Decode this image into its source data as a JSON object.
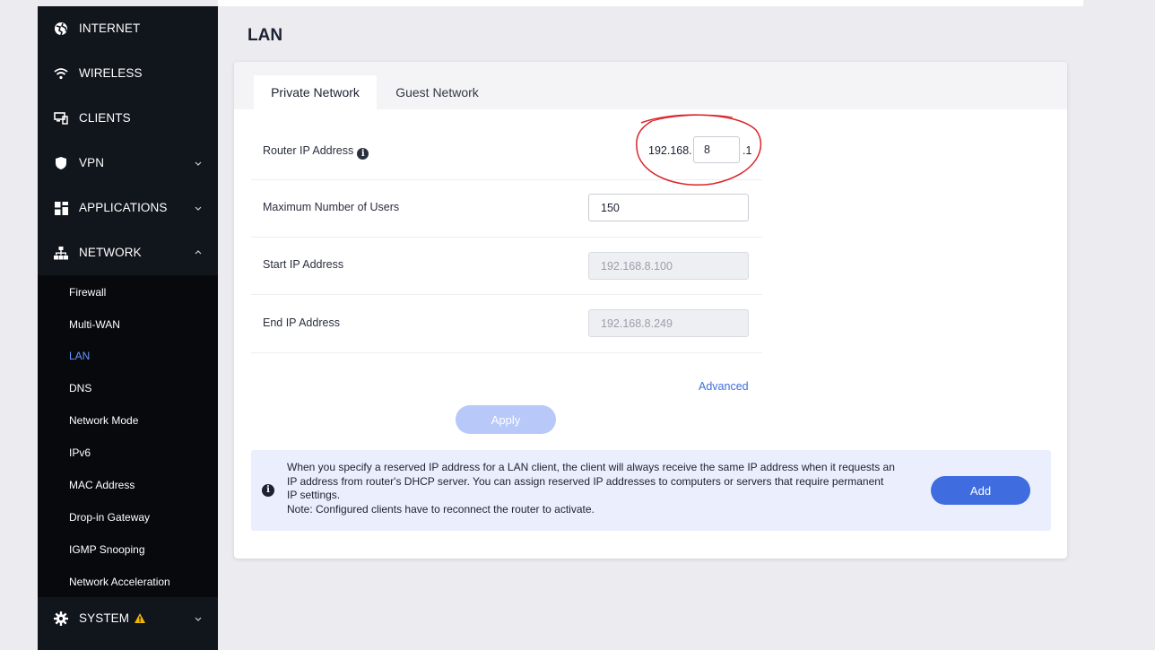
{
  "sidebar": {
    "items": [
      {
        "label": "INTERNET",
        "icon": "globe-icon"
      },
      {
        "label": "WIRELESS",
        "icon": "wifi-icon"
      },
      {
        "label": "CLIENTS",
        "icon": "devices-icon"
      },
      {
        "label": "VPN",
        "icon": "shield-icon"
      },
      {
        "label": "APPLICATIONS",
        "icon": "apps-icon"
      },
      {
        "label": "NETWORK",
        "icon": "network-icon"
      },
      {
        "label": "SYSTEM",
        "icon": "gear-icon"
      }
    ],
    "network_subitems": [
      "Firewall",
      "Multi-WAN",
      "LAN",
      "DNS",
      "Network Mode",
      "IPv6",
      "MAC Address",
      "Drop-in Gateway",
      "IGMP Snooping",
      "Network Acceleration"
    ],
    "active_subitem": "LAN",
    "accent_color": "#6a97ff",
    "warning_color": "#f2b600"
  },
  "page": {
    "title": "LAN",
    "tabs": [
      "Private Network",
      "Guest Network"
    ],
    "active_tab": "Private Network"
  },
  "form": {
    "router_ip_label": "Router IP Address",
    "router_ip_prefix": "192.168.",
    "router_ip_octet": "8",
    "router_ip_suffix": ".1",
    "max_users_label": "Maximum Number of Users",
    "max_users_value": "150",
    "start_ip_label": "Start IP Address",
    "start_ip_value": "192.168.8.100",
    "end_ip_label": "End IP Address",
    "end_ip_value": "192.168.8.249",
    "advanced_label": "Advanced",
    "apply_label": "Apply"
  },
  "notice": {
    "line1": "When you specify a reserved IP address for a LAN client, the client will always receive the same IP address when it requests an",
    "line2": "IP address from router's DHCP server. You can assign reserved IP addresses to computers or servers that require permanent",
    "line3": "IP settings.",
    "line4": "Note: Configured clients have to reconnect the router to activate.",
    "add_label": "Add"
  },
  "annotation": {
    "color": "#d9252a"
  }
}
